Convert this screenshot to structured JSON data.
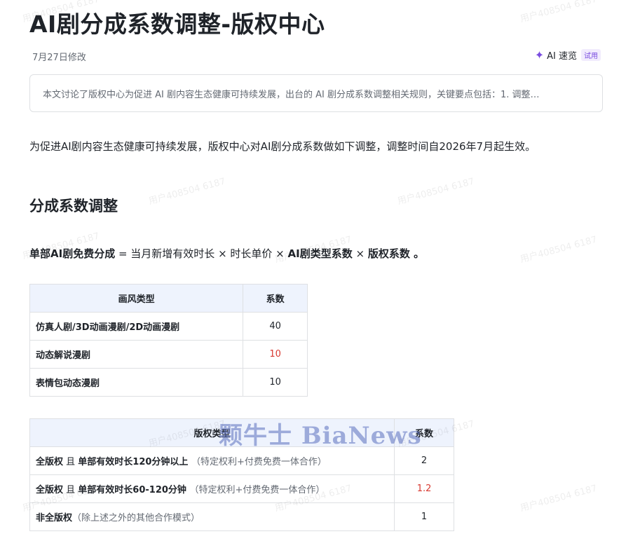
{
  "doc": {
    "title": "AI剧分成系数调整-版权中心",
    "modified": "7月27日修改",
    "ai_label": "AI 速览",
    "trial_label": "试用",
    "summary": "本文讨论了版权中心为促进 AI 剧内容生态健康可持续发展，出台的 AI 剧分成系数调整相关规则，关键要点包括：1. 调整…",
    "intro": "为促进AI剧内容生态健康可持续发展，版权中心对AI剧分成系数做如下调整，调整时间自2026年7月起生效。",
    "section_title": "分成系数调整"
  },
  "formula": {
    "lhs": "单部AI剧免费分成",
    "eq": " = 当月新增有效时长 × 时长单价 × ",
    "term1": "AI剧类型系数",
    "times": " × ",
    "term2": "版权系数",
    "end": " 。"
  },
  "table1": {
    "headers": [
      "画风类型",
      "系数"
    ],
    "rows": [
      {
        "name": "仿真人剧/3D动画漫剧/2D动画漫剧",
        "value": "40"
      },
      {
        "name": "动态解说漫剧",
        "value": "10"
      },
      {
        "name": "表情包动态漫剧",
        "value": "10"
      }
    ]
  },
  "table2": {
    "headers": [
      "版权类型",
      "系数"
    ],
    "rows": [
      {
        "a": "全版权",
        "b": " 且 ",
        "c": "单部有效时长120分钟以上",
        "d": "（特定权利+付费免费一体合作）",
        "value": "2"
      },
      {
        "a": "全版权",
        "b": " 且 ",
        "c": "单部有效时长60-120分钟",
        "d": "（特定权利+付费免费一体合作）",
        "value": "1.2"
      },
      {
        "a": "非全版权",
        "d": "（除上述之外的其他合作模式）",
        "value": "1"
      }
    ]
  },
  "watermarks": {
    "text": "用户408504 6187",
    "logo": "颗牛士 BiaNews"
  },
  "colors": {
    "highlight_red": "#d83931",
    "header_bg": "#eef3fd",
    "ai_purple": "#7a4de0"
  }
}
